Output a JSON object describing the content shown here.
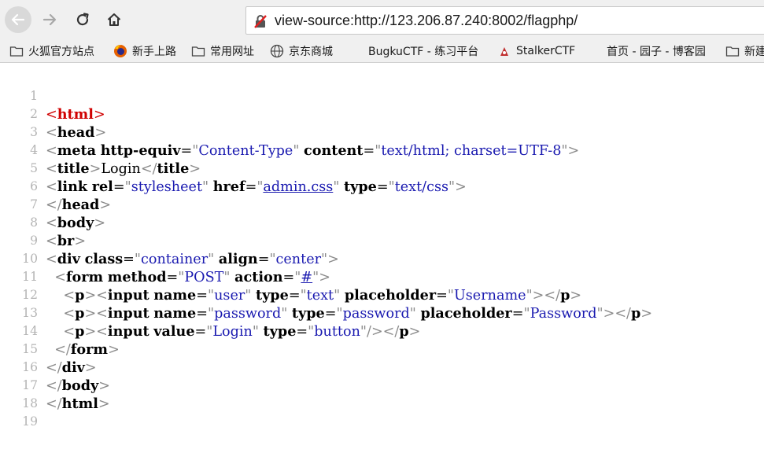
{
  "browser": {
    "url": "view-source:http://123.206.87.240:8002/flagphp/",
    "icons": {
      "back": "back-arrow-icon",
      "forward": "forward-arrow-icon",
      "reload": "reload-icon",
      "home": "home-icon",
      "insecure": "insecure-lock-icon"
    }
  },
  "bookmarks": [
    {
      "label": "火狐官方站点",
      "icon": "folder-icon"
    },
    {
      "label": "新手上路",
      "icon": "firefox-icon"
    },
    {
      "label": "常用网址",
      "icon": "folder-icon"
    },
    {
      "label": "京东商城",
      "icon": "globe-icon"
    },
    {
      "label": "BugkuCTF - 练习平台",
      "icon": ""
    },
    {
      "label": "StalkerCTF",
      "icon": "stalker-icon"
    },
    {
      "label": "首页 - 园子 - 博客园",
      "icon": ""
    },
    {
      "label": "新建",
      "icon": "folder-icon"
    }
  ],
  "source_lines": [
    {
      "n": "1"
    },
    {
      "n": "2"
    },
    {
      "n": "3"
    },
    {
      "n": "4"
    },
    {
      "n": "5"
    },
    {
      "n": "6"
    },
    {
      "n": "7"
    },
    {
      "n": "8"
    },
    {
      "n": "9"
    },
    {
      "n": "10"
    },
    {
      "n": "11"
    },
    {
      "n": "12"
    },
    {
      "n": "13"
    },
    {
      "n": "14"
    },
    {
      "n": "15"
    },
    {
      "n": "16"
    },
    {
      "n": "17"
    },
    {
      "n": "18"
    },
    {
      "n": "19"
    }
  ],
  "code": {
    "html": "html",
    "head": "head",
    "meta": "meta",
    "http_equiv": "http-equiv",
    "content_type": "Content-Type",
    "content": "content",
    "content_value": "text/html; charset=UTF-8",
    "title_tag": "title",
    "title_text": "Login",
    "link": "link",
    "rel": "rel",
    "stylesheet": "stylesheet",
    "href": "href",
    "admin_css": "admin.css",
    "type": "type",
    "text_css": "text/css",
    "body": "body",
    "br": "br",
    "div": "div",
    "class": "class",
    "container": "container",
    "align": "align",
    "center": "center",
    "form": "form",
    "method": "method",
    "post": "POST",
    "action": "action",
    "hash": "#",
    "p": "p",
    "input": "input",
    "name": "name",
    "user": "user",
    "text": "text",
    "placeholder": "placeholder",
    "username": "Username",
    "password": "password",
    "password_ph": "Password",
    "value": "value",
    "login": "Login",
    "button": "button"
  },
  "colors": {
    "tag_name": "#000000",
    "root_tag": "#d00000",
    "attr_value": "#1a1ab0",
    "line_number": "#b4b4b4"
  }
}
